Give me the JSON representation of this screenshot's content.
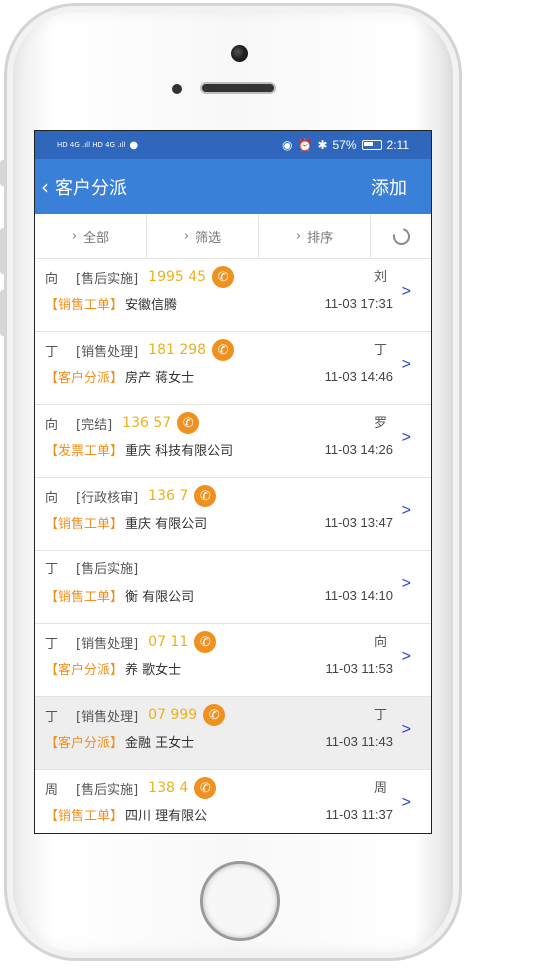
{
  "statusbar": {
    "left": "HD 4G .ıll  HD 4G .ıll",
    "battery": "57%",
    "time": "2:11"
  },
  "nav": {
    "back_icon": "chevron-left-icon",
    "title": "客户分派",
    "add_label": "添加"
  },
  "filters": [
    {
      "label": "全部"
    },
    {
      "label": "筛选"
    },
    {
      "label": "排序"
    }
  ],
  "colors": {
    "statusbar": "#2f67bd",
    "navbar": "#3a7fd8",
    "orange": "#f0901f",
    "phone": "#e9b21d",
    "arrow": "#2746c9"
  },
  "rows": [
    {
      "name": "向",
      "status": "[售后实施]",
      "phone": "1995 45",
      "owner": "刘",
      "tag": "【销售工单】",
      "company": "安徽信腾",
      "time": "11-03 17:31",
      "call": true
    },
    {
      "name": "丁",
      "status": "[销售处理]",
      "phone": "181 298",
      "owner": "丁",
      "tag": "【客户分派】",
      "company": "房产 蒋女士",
      "time": "11-03 14:46",
      "call": true
    },
    {
      "name": "向",
      "status": "[完结]",
      "phone": "136 57",
      "owner": "罗",
      "tag": "【发票工单】",
      "company": "重庆 科技有限公司",
      "time": "11-03 14:26",
      "call": true
    },
    {
      "name": "向",
      "status": "[行政核审]",
      "phone": "136 7",
      "owner": "",
      "tag": "【销售工单】",
      "company": "重庆 有限公司",
      "time": "11-03 13:47",
      "call": true
    },
    {
      "name": "丁",
      "status": "[售后实施]",
      "phone": "",
      "owner": "",
      "tag": "【销售工单】",
      "company": "衡 有限公司",
      "time": "11-03 14:10",
      "call": false
    },
    {
      "name": "丁",
      "status": "[销售处理]",
      "phone": "07 11",
      "owner": "向",
      "tag": "【客户分派】",
      "company": "养 歌女士",
      "time": "11-03 11:53",
      "call": true
    },
    {
      "name": "丁",
      "status": "[销售处理]",
      "phone": "07 999",
      "owner": "丁",
      "tag": "【客户分派】",
      "company": "金融 王女士",
      "time": "11-03 11:43",
      "call": true
    },
    {
      "name": "周",
      "status": "[售后实施]",
      "phone": "138 4",
      "owner": "周",
      "tag": "【销售工单】",
      "company": "四川 理有限公",
      "time": "11-03 11:37",
      "call": true
    }
  ]
}
